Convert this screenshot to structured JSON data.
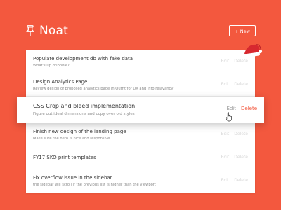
{
  "app": {
    "name": "Noat",
    "new_button_label": "+ New"
  },
  "icons": {
    "logo": "pushpin-icon",
    "decoration": "santa-hat-icon",
    "cursor": "hand-pointer-icon"
  },
  "colors": {
    "background": "#f3583e",
    "card": "#ffffff",
    "accent": "#f3583e",
    "muted_action": "#d6d6d6"
  },
  "actions": {
    "edit": "Edit",
    "delete": "Delete"
  },
  "todos": [
    {
      "title": "Populate development db with fake data",
      "description": "What's up dribbble?"
    },
    {
      "title": "Design Analytics Page",
      "description": "Review design of proposed analytics page in Outfit for UX and info relavancy"
    },
    {
      "title": "CSS Crop and bleed implementation",
      "description": "Figure out ideal dimensions and copy over old styles",
      "active": true
    },
    {
      "title": "Finish new design of the landing page",
      "description": "Make sure the hero is nice and responsive"
    },
    {
      "title": "FY17 SKO print templates",
      "description": ""
    },
    {
      "title": "Fix overflow issue in the sidebar",
      "description": "the sidebar will scroll if the previous list is higher than the viewport"
    }
  ]
}
